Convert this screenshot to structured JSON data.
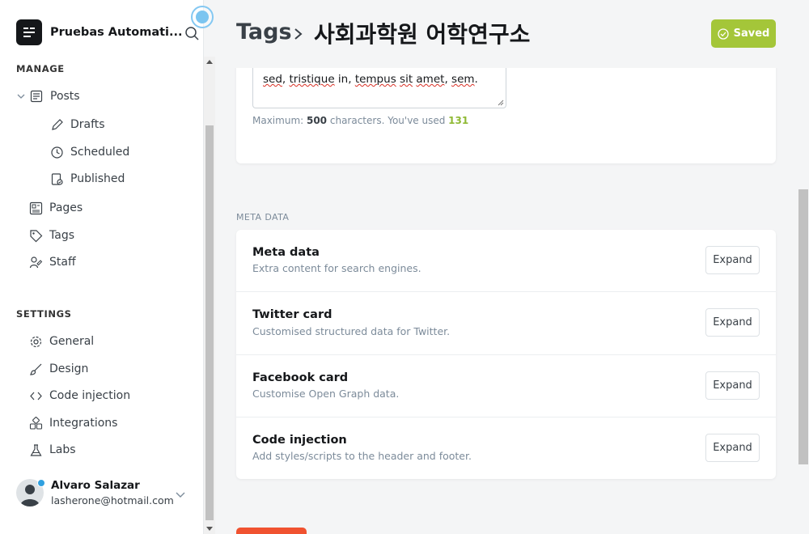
{
  "app": {
    "site_name": "Pruebas Automati...",
    "brand_color": "#15171a"
  },
  "sidebar": {
    "manage_title": "MANAGE",
    "settings_title": "SETTINGS",
    "posts": {
      "label": "Posts",
      "expanded": true
    },
    "posts_children": [
      {
        "label": "Drafts",
        "icon": "pencil-icon"
      },
      {
        "label": "Scheduled",
        "icon": "clock-icon"
      },
      {
        "label": "Published",
        "icon": "published-icon"
      }
    ],
    "manage_items": [
      {
        "label": "Pages",
        "icon": "pages-icon"
      },
      {
        "label": "Tags",
        "icon": "tag-icon"
      },
      {
        "label": "Staff",
        "icon": "staff-icon"
      }
    ],
    "settings_items": [
      {
        "label": "General",
        "icon": "gear-icon"
      },
      {
        "label": "Design",
        "icon": "brush-icon"
      },
      {
        "label": "Code injection",
        "icon": "code-icon"
      },
      {
        "label": "Integrations",
        "icon": "integrations-icon"
      },
      {
        "label": "Labs",
        "icon": "flask-icon"
      }
    ],
    "user": {
      "name": "Alvaro Salazar",
      "email": "lasherone@hotmail.com"
    }
  },
  "header": {
    "breadcrumb_root": "Tags",
    "breadcrumb_current": "사회과학원 어학연구소",
    "saved_label": "Saved",
    "saved_color": "#a4c639"
  },
  "description_card": {
    "textarea_visible_text_parts": [
      "sed",
      ", ",
      "tristique",
      " in, ",
      "tempus",
      " ",
      "sit",
      " ",
      "amet",
      ", ",
      "sem",
      "."
    ],
    "counter_prefix": "Maximum: ",
    "counter_max": "500",
    "counter_middle": " characters. You've used ",
    "counter_used": "131"
  },
  "meta": {
    "section_title": "META DATA",
    "rows": [
      {
        "title": "Meta data",
        "desc": "Extra content for search engines.",
        "button": "Expand"
      },
      {
        "title": "Twitter card",
        "desc": "Customised structured data for Twitter.",
        "button": "Expand"
      },
      {
        "title": "Facebook card",
        "desc": "Customise Open Graph data.",
        "button": "Expand"
      },
      {
        "title": "Code injection",
        "desc": "Add styles/scripts to the header and footer.",
        "button": "Expand"
      }
    ]
  },
  "colors": {
    "delete_accent": "#f05230",
    "counter_used": "#8fb934"
  }
}
